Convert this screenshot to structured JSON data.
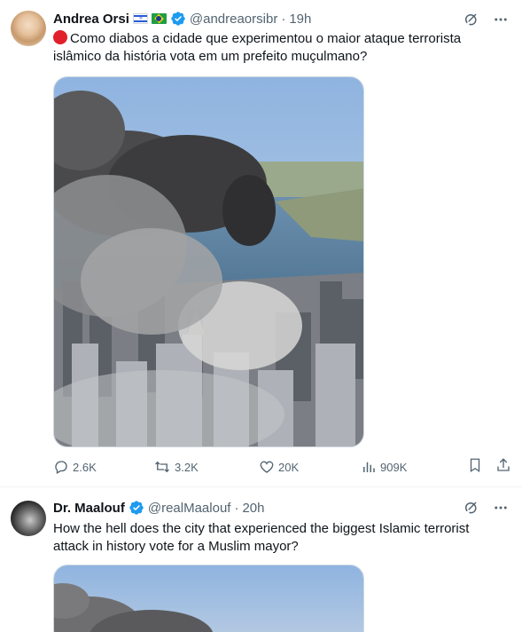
{
  "tweets": [
    {
      "author_name": "Andrea Orsi",
      "flags": [
        "israel-flag",
        "brazil-flag"
      ],
      "verified": true,
      "handle": "@andreaorsibr",
      "separator": "·",
      "time": "19h",
      "text": "Como diabos a cidade que experimentou o maior ataque terrorista islâmico da história vota em um prefeito muçulmano?",
      "leading_emoji": "red-circle",
      "media": "aerial photo of smoking skyscrapers",
      "stats": {
        "replies": "2.6K",
        "retweets": "3.2K",
        "likes": "20K",
        "views": "909K"
      }
    },
    {
      "author_name": "Dr. Maalouf",
      "verified": true,
      "handle": "@realMaalouf",
      "separator": "·",
      "time": "20h",
      "text": "How the hell does the city that experienced the biggest Islamic terrorist attack in history vote for a Muslim mayor?",
      "media": "aerial photo of smoking skyscrapers"
    }
  ],
  "colors": {
    "verified_blue": "#1d9bf0",
    "text_secondary": "#536471",
    "text_primary": "#0f1419",
    "divider": "#eff3f4"
  }
}
